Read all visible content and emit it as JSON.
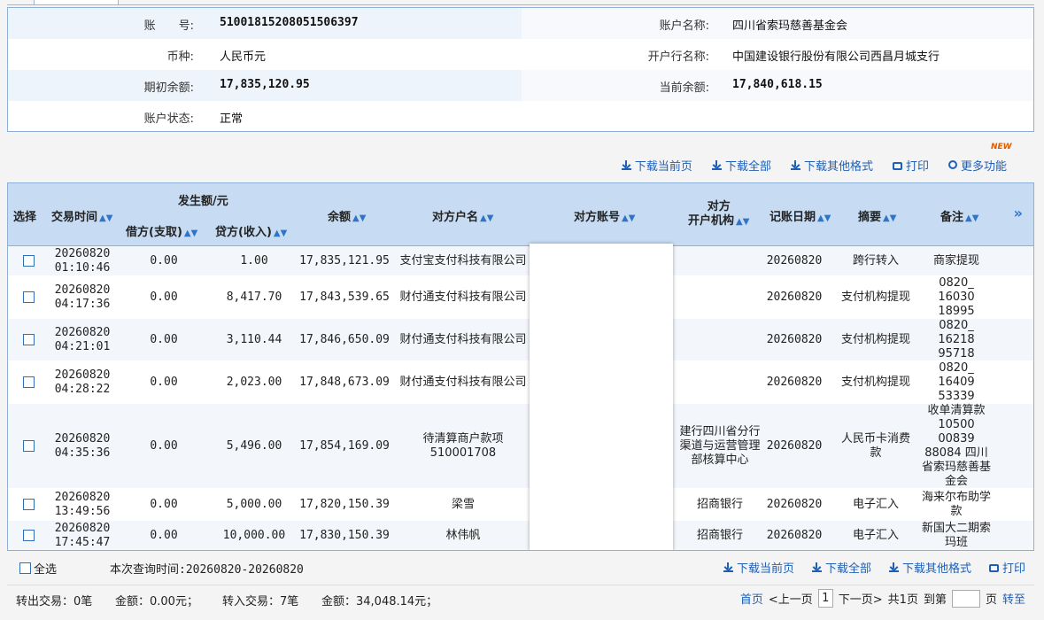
{
  "info": {
    "account_no_label": "账　　号:",
    "account_no": "51001815208051506397",
    "account_name_label": "账户名称:",
    "account_name": "四川省索玛慈善基金会",
    "currency_label": "币种:",
    "currency": "人民币元",
    "bank_label": "开户行名称:",
    "bank": "中国建设银行股份有限公司西昌月城支行",
    "opening_label": "期初余额:",
    "opening": "17,835,120.95",
    "current_label": "当前余额:",
    "current": "17,840,618.15",
    "status_label": "账户状态:",
    "status": "正常"
  },
  "toolbar": {
    "new_tag": "NEW",
    "download_page": "下载当前页",
    "download_all": "下载全部",
    "download_other": "下载其他格式",
    "print": "打印",
    "more": "更多功能"
  },
  "table": {
    "headers": {
      "select": "选择",
      "time": "交易时间",
      "amount_group": "发生额/元",
      "debit": "借方(支取)",
      "credit": "贷方(收入)",
      "balance": "余额",
      "cp_name": "对方户名",
      "cp_account": "对方账号",
      "cp_bank_1": "对方",
      "cp_bank_2": "开户机构",
      "post_date": "记账日期",
      "summary": "摘要",
      "remark": "备注",
      "more_cols": "»"
    },
    "rows": [
      {
        "time1": "20260820",
        "time2": "01:10:46",
        "debit": "0.00",
        "credit": "1.00",
        "balance": "17,835,121.95",
        "cp_name": "支付宝支付科技有限公司",
        "cp_bank": "",
        "date": "20260820",
        "summary": "跨行转入",
        "remark": "商家提现"
      },
      {
        "time1": "20260820",
        "time2": "04:17:36",
        "debit": "0.00",
        "credit": "8,417.70",
        "balance": "17,843,539.65",
        "cp_name": "财付通支付科技有限公司",
        "cp_bank": "",
        "date": "20260820",
        "summary": "支付机构提现",
        "remark": "0820_ 16030 18995"
      },
      {
        "time1": "20260820",
        "time2": "04:21:01",
        "debit": "0.00",
        "credit": "3,110.44",
        "balance": "17,846,650.09",
        "cp_name": "财付通支付科技有限公司",
        "cp_bank": "",
        "date": "20260820",
        "summary": "支付机构提现",
        "remark": "0820_ 16218 95718"
      },
      {
        "time1": "20260820",
        "time2": "04:28:22",
        "debit": "0.00",
        "credit": "2,023.00",
        "balance": "17,848,673.09",
        "cp_name": "财付通支付科技有限公司",
        "cp_bank": "",
        "date": "20260820",
        "summary": "支付机构提现",
        "remark": "0820_ 16409 53339"
      },
      {
        "time1": "20260820",
        "time2": "04:35:36",
        "debit": "0.00",
        "credit": "5,496.00",
        "balance": "17,854,169.09",
        "cp_name": "待清算商户款项510001708",
        "cp_bank": "建行四川省分行渠道与运营管理部核算中心",
        "date": "20260820",
        "summary": "人民币卡消费款",
        "remark": "收单清算款 10500 00839 88084 四川省索玛慈善基金会"
      },
      {
        "time1": "20260820",
        "time2": "13:49:56",
        "debit": "0.00",
        "credit": "5,000.00",
        "balance": "17,820,150.39",
        "cp_name": "梁雪",
        "cp_bank": "招商银行",
        "date": "20260820",
        "summary": "电子汇入",
        "remark": "海来尔布助学款"
      },
      {
        "time1": "20260820",
        "time2": "17:45:47",
        "debit": "0.00",
        "credit": "10,000.00",
        "balance": "17,830,150.39",
        "cp_name": "林伟帆",
        "cp_bank": "招商银行",
        "date": "20260820",
        "summary": "电子汇入",
        "remark": "新国大二期索玛班"
      }
    ]
  },
  "footer": {
    "select_all": "全选",
    "query_time": "本次查询时间:20260820-20260820",
    "download_page": "下载当前页",
    "download_all": "下载全部",
    "download_other": "下载其他格式",
    "print": "打印",
    "out_tx": "转出交易：0笔",
    "out_amount": "金额：0.00元；",
    "in_tx": "转入交易：7笔",
    "in_amount": "金额：34,048.14元；",
    "first": "首页",
    "prev": "<上一页",
    "cur_page": "1",
    "next": "下一页>",
    "total": "共1页",
    "goto": "到第",
    "page_unit": "页",
    "go": "转至"
  }
}
